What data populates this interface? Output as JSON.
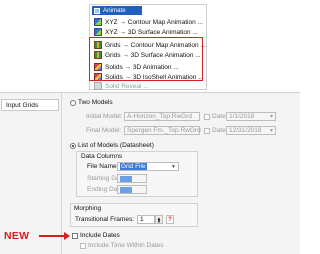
{
  "menu": {
    "title": "Animate",
    "items": [
      {
        "label": "XYZ → Contour Map Animation ...",
        "icon": "xyz-contour-icon",
        "disabled": false
      },
      {
        "label": "XYZ → 3D Surface Animation ...",
        "icon": "xyz-surface-icon",
        "disabled": false
      },
      {
        "label": "Grids → Contour Map Animation ...",
        "icon": "grids-contour-icon",
        "disabled": false
      },
      {
        "label": "Grids → 3D Surface Animation ...",
        "icon": "grids-surface-icon",
        "disabled": false
      },
      {
        "label": "Solids → 3D Animation ...",
        "icon": "solids-3d-icon",
        "disabled": false
      },
      {
        "label": "Solids → 3D IsoShell Animation ...",
        "icon": "solids-isoshell-icon",
        "disabled": false
      },
      {
        "label": "Solid Reveal ...",
        "icon": "solid-reveal-icon",
        "disabled": true
      }
    ],
    "highlight_color": "#d62020"
  },
  "dialog": {
    "tab": "Input Grids",
    "two_models": {
      "label": "Two Models",
      "initial_model_label": "Initial Model:",
      "initial_model_value": "A-Horizon_Top.RwGrd",
      "initial_date_label": "Date:",
      "initial_date_value": "1/1/2018",
      "final_model_label": "Final Model:",
      "final_model_value": "Spergen Fm._Top.RwGrd",
      "final_date_label": "Date:",
      "final_date_value": "12/31/2018"
    },
    "list_of_models": {
      "label": "List of Models (Datasheet)",
      "data_columns_label": "Data Columns",
      "file_name_label": "File Name:",
      "file_name_value": "Grid File",
      "starting_date_label": "Starting Date:",
      "ending_date_label": "Ending Date:"
    },
    "morphing": {
      "label": "Morphing",
      "transitional_frames_label": "Transitional Frames:",
      "transitional_frames_value": "1",
      "help_label": "?"
    },
    "include_dates_label": "Include Dates",
    "include_time_label": "Include Time Within Dates"
  },
  "annotation": {
    "new_label": "NEW",
    "color": "#d62020"
  }
}
